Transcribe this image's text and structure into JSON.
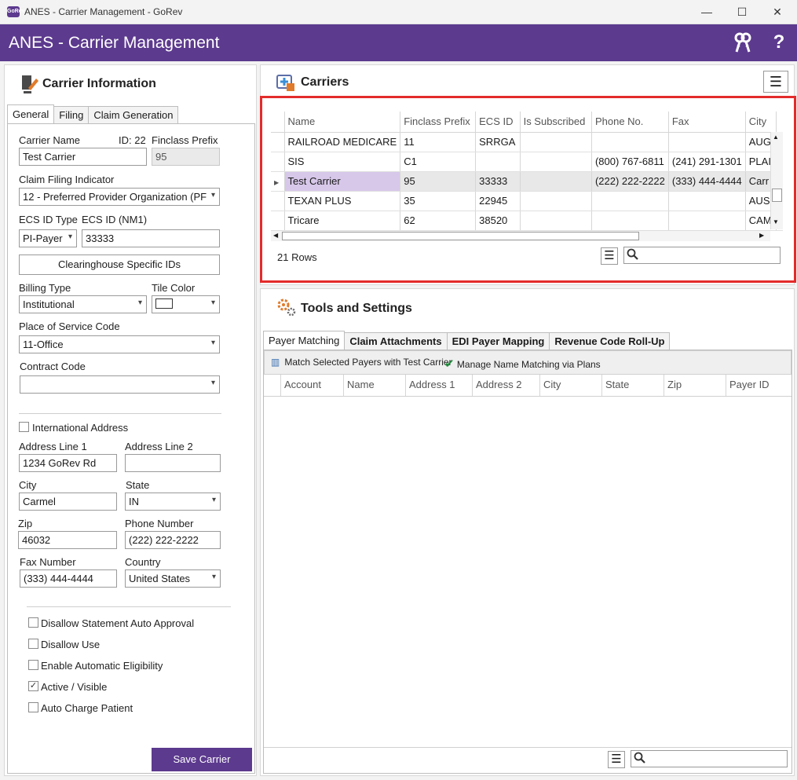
{
  "window": {
    "app_icon_text": "GoRev",
    "title": "ANES - Carrier Management - GoRev",
    "min": "—",
    "max": "☐",
    "close": "✕"
  },
  "header": {
    "title": "ANES - Carrier Management",
    "help": "?"
  },
  "carrier_info": {
    "title": "Carrier Information",
    "tabs": [
      "General",
      "Filing",
      "Claim Generation"
    ],
    "carrier_name_label": "Carrier Name",
    "id_label": "ID: 22",
    "finclass_prefix_label": "Finclass Prefix",
    "carrier_name_value": "Test Carrier",
    "finclass_prefix_value": "95",
    "claim_filing_label": "Claim Filing Indicator",
    "claim_filing_value": "12 - Preferred Provider Organization (PF",
    "ecs_id_type_label": "ECS ID Type",
    "ecs_id_label": "ECS ID (NM1)",
    "ecs_id_type_value": "PI-Payer",
    "ecs_id_value": "33333",
    "clearinghouse_button": "Clearinghouse Specific IDs",
    "billing_type_label": "Billing Type",
    "tile_color_label": "Tile Color",
    "billing_type_value": "Institutional",
    "pos_label": "Place of Service Code",
    "pos_value": "11-Office",
    "contract_code_label": "Contract Code",
    "contract_code_value": "",
    "international_label": "International Address",
    "addr1_label": "Address Line 1",
    "addr2_label": "Address Line 2",
    "addr1_value": "1234 GoRev Rd",
    "addr2_value": "",
    "city_label": "City",
    "state_label": "State",
    "city_value": "Carmel",
    "state_value": "IN",
    "zip_label": "Zip",
    "phone_label": "Phone Number",
    "zip_value": "46032",
    "phone_value": "(222) 222-2222",
    "fax_label": "Fax Number",
    "country_label": "Country",
    "fax_value": "(333) 444-4444",
    "country_value": "United States",
    "checkboxes": [
      {
        "label": "Disallow Statement Auto Approval",
        "checked": false
      },
      {
        "label": "Disallow Use",
        "checked": false
      },
      {
        "label": "Enable Automatic Eligibility",
        "checked": false
      },
      {
        "label": "Active / Visible",
        "checked": true
      },
      {
        "label": "Auto Charge Patient",
        "checked": false
      }
    ],
    "save_button": "Save Carrier"
  },
  "carriers": {
    "title": "Carriers",
    "columns": [
      "Name",
      "Finclass Prefix",
      "ECS ID",
      "Is Subscribed",
      "Phone No.",
      "Fax",
      "City"
    ],
    "rows": [
      [
        "RAILROAD MEDICARE",
        "11",
        "SRRGA",
        "",
        "",
        "",
        "AUG"
      ],
      [
        "SIS",
        "C1",
        "",
        "",
        "(800) 767-6811",
        "(241) 291-1301",
        "PLAI"
      ],
      [
        "Test Carrier",
        "95",
        "33333",
        "",
        "(222) 222-2222",
        "(333) 444-4444",
        "Carr"
      ],
      [
        "TEXAN PLUS",
        "35",
        "22945",
        "",
        "",
        "",
        "AUS"
      ],
      [
        "Tricare",
        "62",
        "38520",
        "",
        "",
        "",
        "CAM"
      ]
    ],
    "selected_row": 2,
    "row_count": "21 Rows",
    "search_placeholder": ""
  },
  "tools": {
    "title": "Tools and Settings",
    "tabs": [
      "Payer Matching",
      "Claim Attachments",
      "EDI Payer Mapping",
      "Revenue Code Roll-Up"
    ],
    "toolbar": [
      "Match Selected Payers with Test Carrier",
      "Manage Name Matching via Plans"
    ],
    "columns": [
      "Account",
      "Name",
      "Address 1",
      "Address 2",
      "City",
      "State",
      "Zip",
      "Payer ID"
    ]
  },
  "colors": {
    "brand": "#5c3a8e",
    "highlight": "#e32b2b",
    "selected_name": "#d7c8ea"
  }
}
